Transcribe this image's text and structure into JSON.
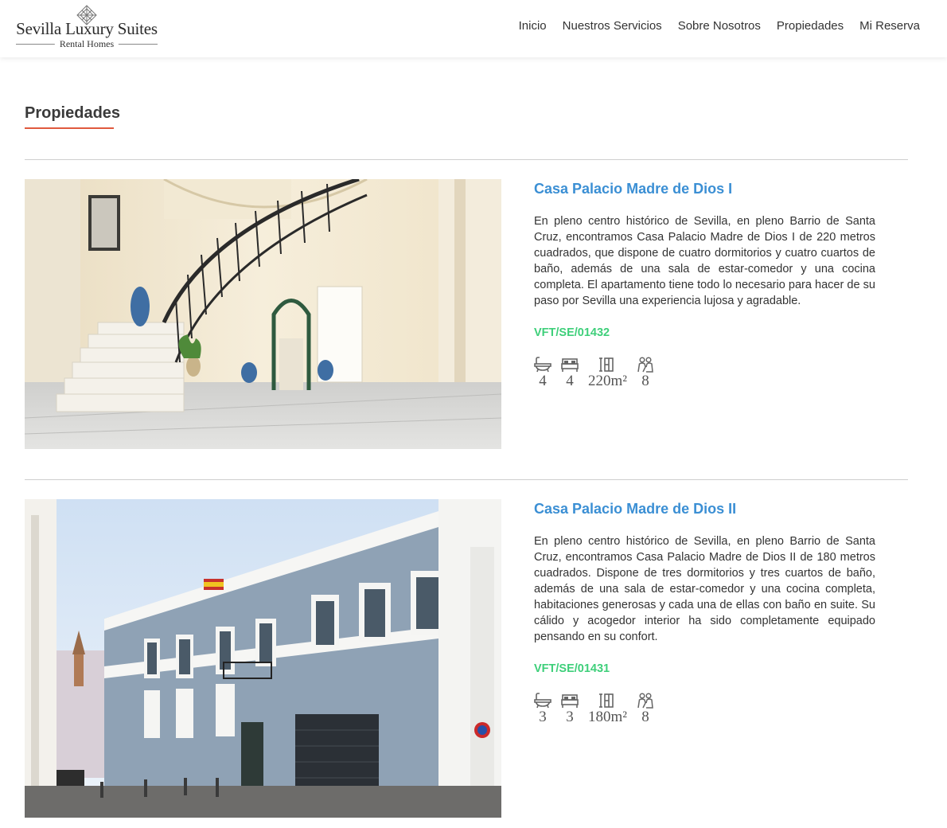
{
  "logo": {
    "title": "Sevilla Luxury Suites",
    "subtitle": "Rental Homes"
  },
  "nav": [
    "Inicio",
    "Nuestros Servicios",
    "Sobre Nosotros",
    "Propiedades",
    "Mi Reserva"
  ],
  "page": {
    "title": "Propiedades",
    "accent_color": "#e05a3e"
  },
  "colors": {
    "link_blue": "#3b8fd4",
    "license_green": "#3ecf7a"
  },
  "properties": [
    {
      "title": "Casa Palacio Madre de Dios I",
      "description": "En pleno centro histórico de Sevilla, en pleno Barrio de Santa Cruz, encontramos Casa Palacio Madre de Dios I de 220 metros cuadrados, que dispone de cuatro dormitorios y cuatro cuartos de baño, además de una sala de estar-comedor y una cocina completa. El apartamento tiene todo lo necesario para hacer de su paso por Sevilla una experiencia lujosa y agradable.",
      "license": "VFT/SE/01432",
      "features": {
        "baths": "4",
        "beds": "4",
        "area": "220m²",
        "guests": "8"
      },
      "photo_icon": "staircase-photo"
    },
    {
      "title": "Casa Palacio Madre de Dios II",
      "description": "En pleno centro histórico de Sevilla, en pleno Barrio de Santa Cruz, encontramos Casa Palacio Madre de Dios II de 180 metros cuadrados. Dispone de tres dormitorios y tres cuartos de baño, además de una sala de estar-comedor y una cocina completa, habitaciones generosas y cada una de ellas con baño en suite. Su cálido y acogedor interior ha sido completamente equipado pensando en su confort.",
      "license": "VFT/SE/01431",
      "features": {
        "baths": "3",
        "beds": "3",
        "area": "180m²",
        "guests": "8"
      },
      "photo_icon": "facade-photo"
    }
  ]
}
